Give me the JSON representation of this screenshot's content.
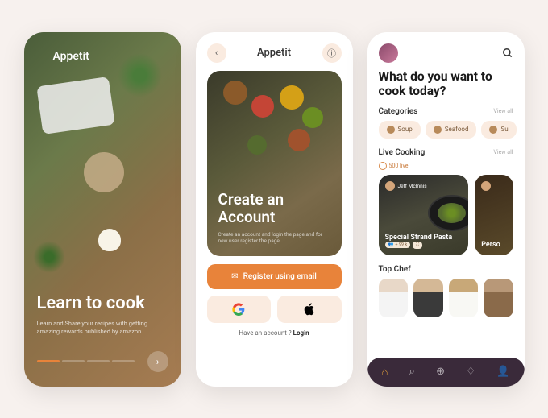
{
  "screen1": {
    "brand": "Appetit",
    "headline": "Learn to cook",
    "sub": "Learn and Share your recipes with getting amazing rewards published by amazon"
  },
  "screen2": {
    "title": "Appetit",
    "hero_title": "Create an Account",
    "hero_sub": "Create an account and login the page and for new user register the page",
    "cta": "Register using email",
    "login_prompt": "Have an account ?",
    "login_link": "Login"
  },
  "screen3": {
    "headline": "What do you want to cook today?",
    "categories_title": "Categories",
    "categories_viewall": "View all",
    "cats": [
      "Soup",
      "Seafood",
      "Su"
    ],
    "live_title": "Live Cooking",
    "live_count": "500 live",
    "live_viewall": "View all",
    "card1_chef": "Jeff McInnis",
    "card1_title": "Special Strand Pasta",
    "card1_likes": "+ 99 k",
    "card2_title": "Perso",
    "topchef_title": "Top Chef"
  }
}
